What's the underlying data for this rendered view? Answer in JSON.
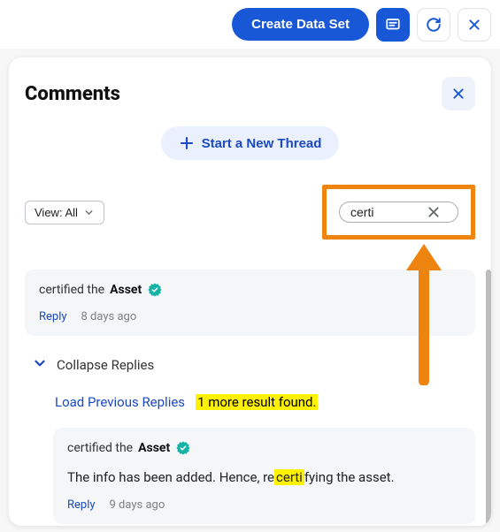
{
  "toolbar": {
    "create_label": "Create Data Set"
  },
  "panel": {
    "title": "Comments",
    "new_thread_label": "Start a New Thread",
    "view_filter": {
      "label_prefix": "View: ",
      "selected": "All"
    },
    "search": {
      "value": "certi"
    },
    "comments": [
      {
        "action_prefix": "certified the ",
        "asset_word": "Asset",
        "reply_label": "Reply",
        "time": "8 days ago"
      }
    ],
    "collapse_label": "Collapse Replies",
    "load_previous_label": "Load Previous Replies",
    "more_results_text": "1 more result found.",
    "nested": {
      "action_prefix": "certified the ",
      "asset_word": "Asset",
      "body_before": "The info has been added. Hence, re",
      "body_highlight": "certi",
      "body_after": "fying the asset.",
      "reply_label": "Reply",
      "time": "9 days ago"
    }
  }
}
